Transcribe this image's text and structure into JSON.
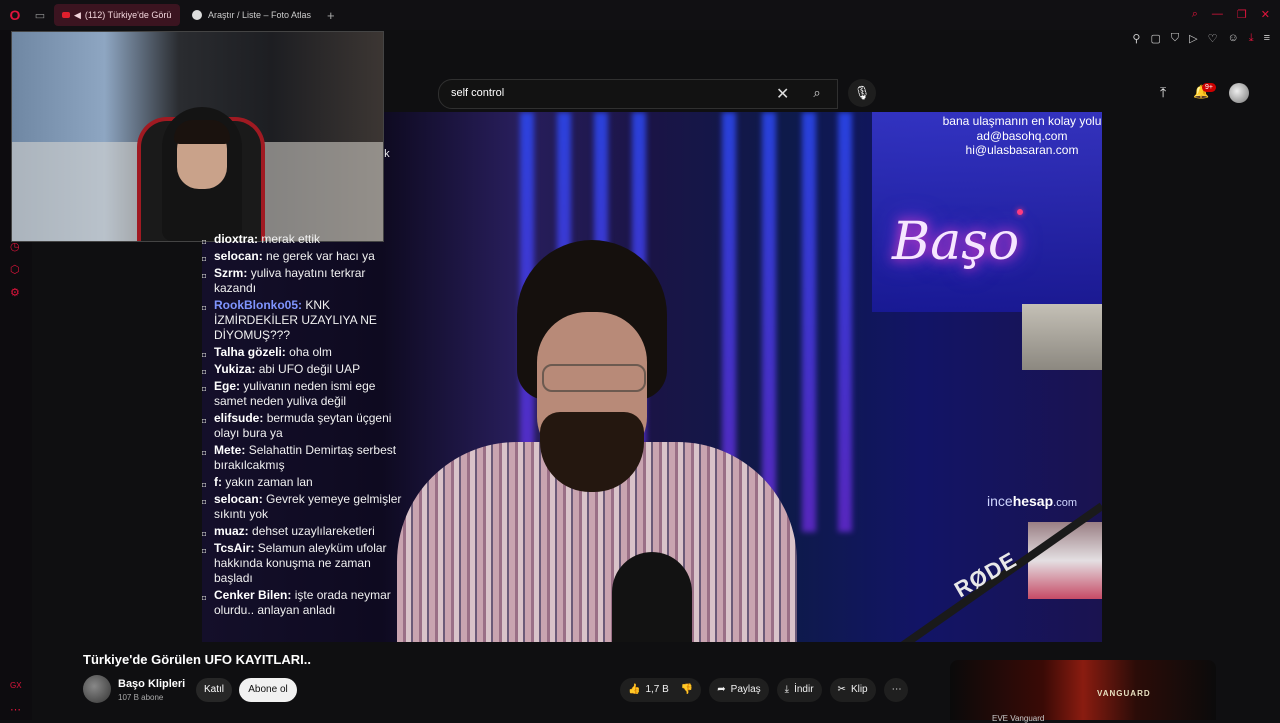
{
  "browser": {
    "tabs": [
      {
        "label": "(112) Türkiye'de Görü",
        "active": true
      },
      {
        "label": "Araştır / Liste – Foto Atlas",
        "active": false
      }
    ],
    "new_tab": "+",
    "icons": [
      "opera-logo-icon",
      "speaker-icon",
      "bookmark-icon",
      "snapshot-icon",
      "shield-icon",
      "play-icon",
      "heart-icon",
      "account-icon",
      "download-icon",
      "menu-icon"
    ]
  },
  "search": {
    "value": "self control"
  },
  "header": {
    "notifications_badge": "9+"
  },
  "video": {
    "contact_lines": [
      "bana ulaşmanın en kolay yolu",
      "ad@basohq.com",
      "hi@ulasbasaran.com"
    ],
    "neon_text": "Başo",
    "sponsor": {
      "light": "ince",
      "bold": "hesap",
      "suffix": ".com"
    },
    "mic_brand": "RØDE",
    "webcam_label": "ek"
  },
  "chat": [
    {
      "user": "dioxtra:",
      "text": "merak ettik",
      "color": "#ffffff"
    },
    {
      "user": "selocan:",
      "text": "ne gerek var hacı ya",
      "color": "#ffffff"
    },
    {
      "user": "Szrm:",
      "text": "yuliva hayatını terkrar kazandı",
      "color": "#ffffff"
    },
    {
      "user": "RookBlonko05:",
      "text": "KNK İZMİRDEKİLER UZAYLIYA NE DİYOMUŞ???",
      "color": "#7f95ff"
    },
    {
      "user": "Talha gözeli:",
      "text": "oha olm",
      "color": "#ffffff"
    },
    {
      "user": "Yukiza:",
      "text": "abi UFO değil UAP",
      "color": "#ffffff"
    },
    {
      "user": "Ege:",
      "text": "yulivanın neden ismi ege samet neden yuliva değil",
      "color": "#ffffff"
    },
    {
      "user": "elifsude:",
      "text": "bermuda şeytan üçgeni olayı bura ya",
      "color": "#ffffff"
    },
    {
      "user": "Mete:",
      "text": "Selahattin Demirtaş serbest bırakılcakmış",
      "color": "#ffffff"
    },
    {
      "user": "f:",
      "text": "yakın zaman lan",
      "color": "#ffffff"
    },
    {
      "user": "selocan:",
      "text": "Gevrek yemeye gelmişler sıkıntı yok",
      "color": "#ffffff"
    },
    {
      "user": "muaz:",
      "text": "dehset uzaylılareketleri",
      "color": "#ffffff"
    },
    {
      "user": "TcsAir:",
      "text": "Selamun aleyküm ufolar hakkında konuşma ne zaman başladı",
      "color": "#ffffff"
    },
    {
      "user": "Cenker Bilen:",
      "text": "işte orada neymar olurdu.. anlayan anladı",
      "color": "#ffffff"
    }
  ],
  "below": {
    "title": "Türkiye'de Görülen UFO KAYITLARI..",
    "channel_name": "Başo Klipleri",
    "subscribers": "107 B abone",
    "join_label": "Katıl",
    "subscribe_label": "Abone ol",
    "likes": "1,7 B",
    "share_label": "Paylaş",
    "download_label": "İndir",
    "clip_label": "Klip",
    "more_label": "⋯"
  },
  "ad": {
    "brand": "VANGUARD",
    "teaser": "EVE Vanguard"
  }
}
